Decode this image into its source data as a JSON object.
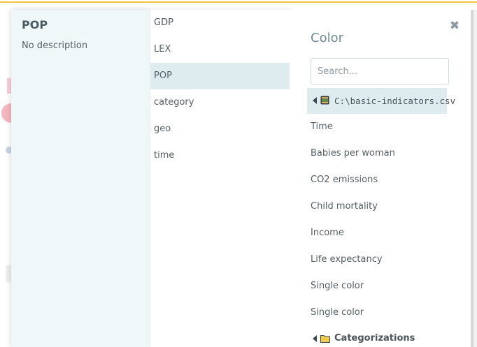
{
  "description_panel": {
    "title": "POP",
    "text": "No description"
  },
  "indicator_list": {
    "items": [
      {
        "label": "GDP"
      },
      {
        "label": "LEX"
      },
      {
        "label": "POP",
        "selected": true
      },
      {
        "label": "category"
      },
      {
        "label": "geo"
      },
      {
        "label": "time"
      }
    ]
  },
  "color_panel": {
    "title": "Color",
    "close_icon": "close-icon",
    "close_symbol": "✖",
    "search": {
      "placeholder": "Search...",
      "value": ""
    },
    "source": {
      "label": "C:\\basic-indicators.csv",
      "icon": "database-icon",
      "expanded": true
    },
    "items": [
      {
        "label": "Time"
      },
      {
        "label": "Babies per woman"
      },
      {
        "label": "CO2 emissions"
      },
      {
        "label": "Child mortality"
      },
      {
        "label": "Income"
      },
      {
        "label": "Life expectancy"
      },
      {
        "label": "Single color"
      },
      {
        "label": "Single color"
      }
    ],
    "categorizations": {
      "label": "Categorizations",
      "icon": "folder-icon"
    }
  },
  "colors": {
    "accent_top": "#f5c043",
    "selected_bg": "#dfecef",
    "description_bg": "#f0f7f9",
    "title_color": "#6f8a96"
  }
}
